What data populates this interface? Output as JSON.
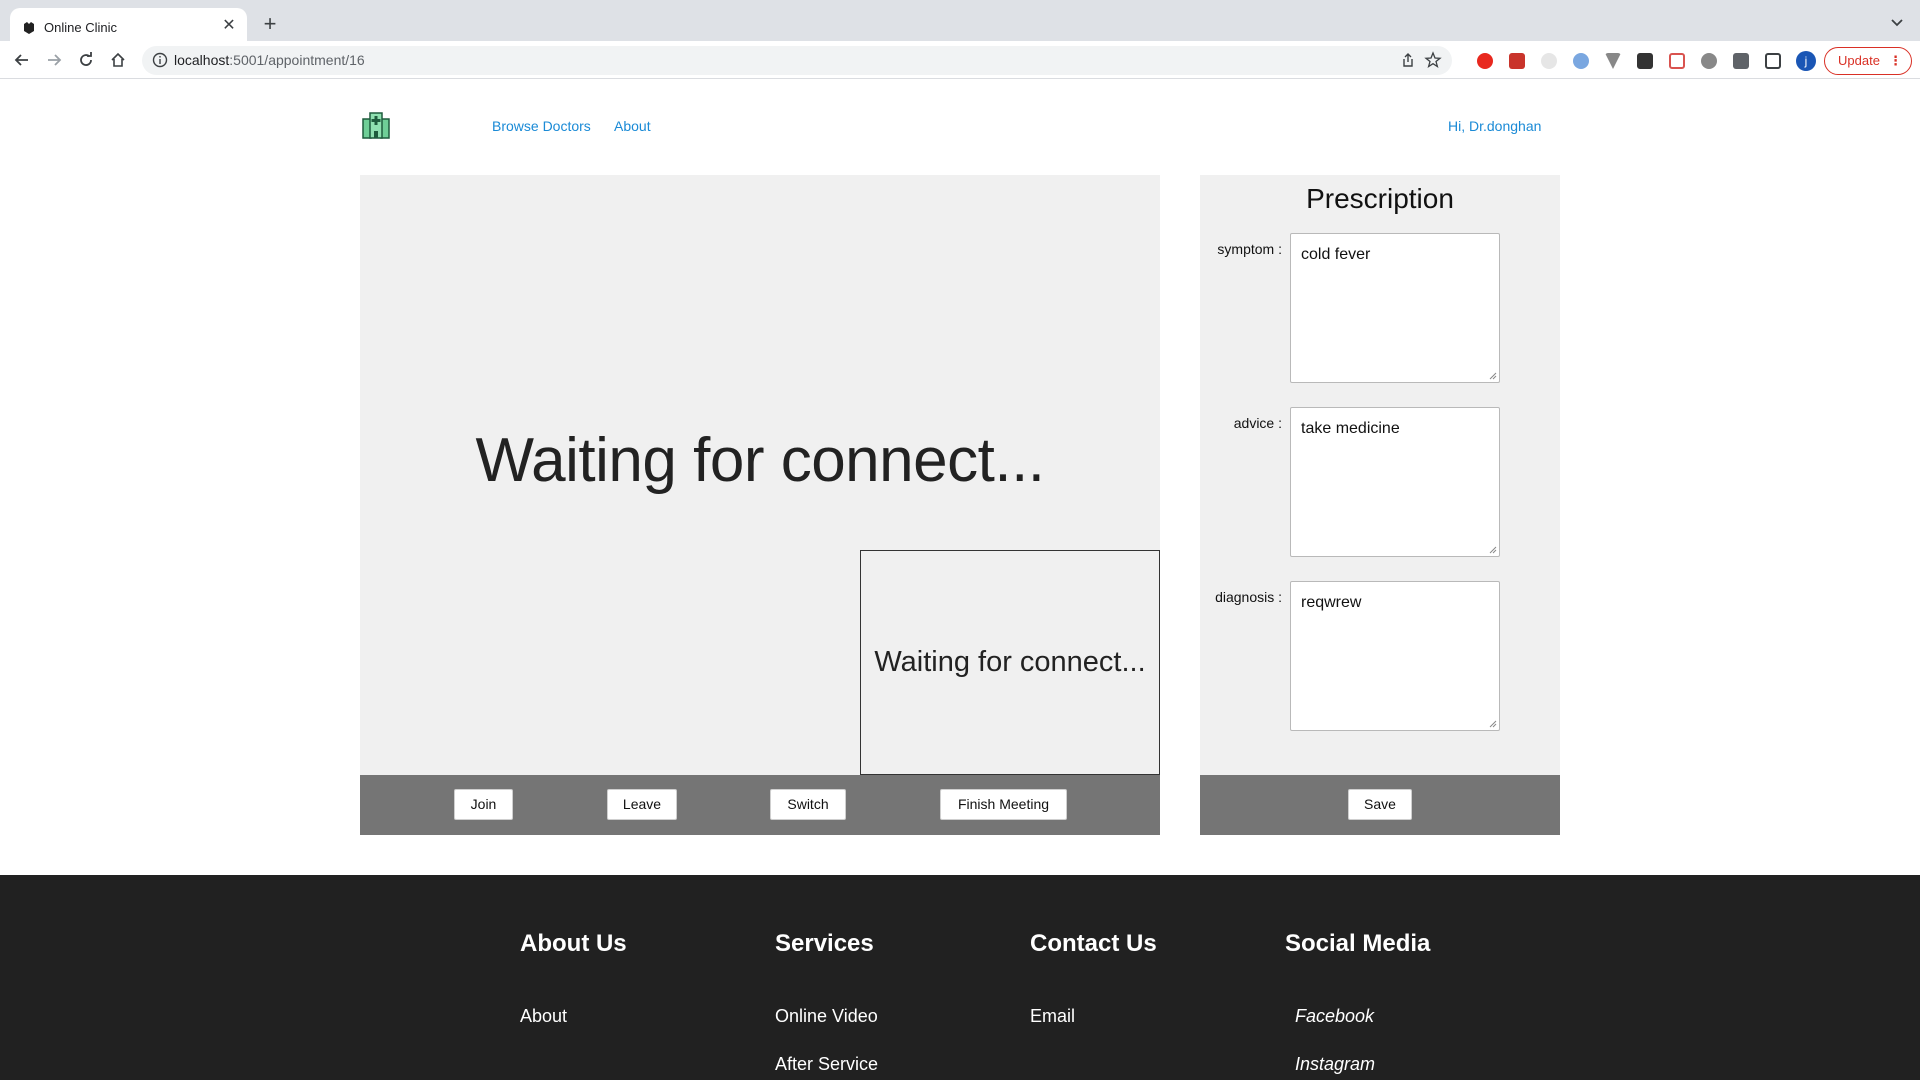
{
  "browser": {
    "tab_title": "Online Clinic",
    "url_host": "localhost",
    "url_rest": ":5001/appointment/16",
    "profile_initial": "j",
    "update_label": "Update"
  },
  "header": {
    "nav": [
      "Browse Doctors",
      "About"
    ],
    "greeting": "Hi, Dr.donghan"
  },
  "video": {
    "main_status": "Waiting for connect...",
    "local_status": "Waiting for connect...",
    "controls": {
      "join": "Join",
      "leave": "Leave",
      "switch": "Switch",
      "finish": "Finish Meeting"
    }
  },
  "prescription": {
    "title": "Prescription",
    "fields": [
      {
        "label": "symptom :",
        "value": "cold fever"
      },
      {
        "label": "advice :",
        "value": "take medicine"
      },
      {
        "label": "diagnosis :",
        "value": "reqwrew"
      }
    ],
    "save_label": "Save"
  },
  "footer": {
    "columns": [
      {
        "heading": "About Us",
        "links": [
          "About"
        ]
      },
      {
        "heading": "Services",
        "links": [
          "Online Video",
          "After Service"
        ]
      },
      {
        "heading": "Contact Us",
        "links": [
          "Email"
        ]
      },
      {
        "heading": "Social Media",
        "links": [
          "Facebook",
          "Instagram"
        ]
      }
    ]
  },
  "colors": {
    "link": "#1a8ad6",
    "panel_bg": "#f0f0f0",
    "control_bar": "#757575",
    "footer_bg": "#212121"
  }
}
